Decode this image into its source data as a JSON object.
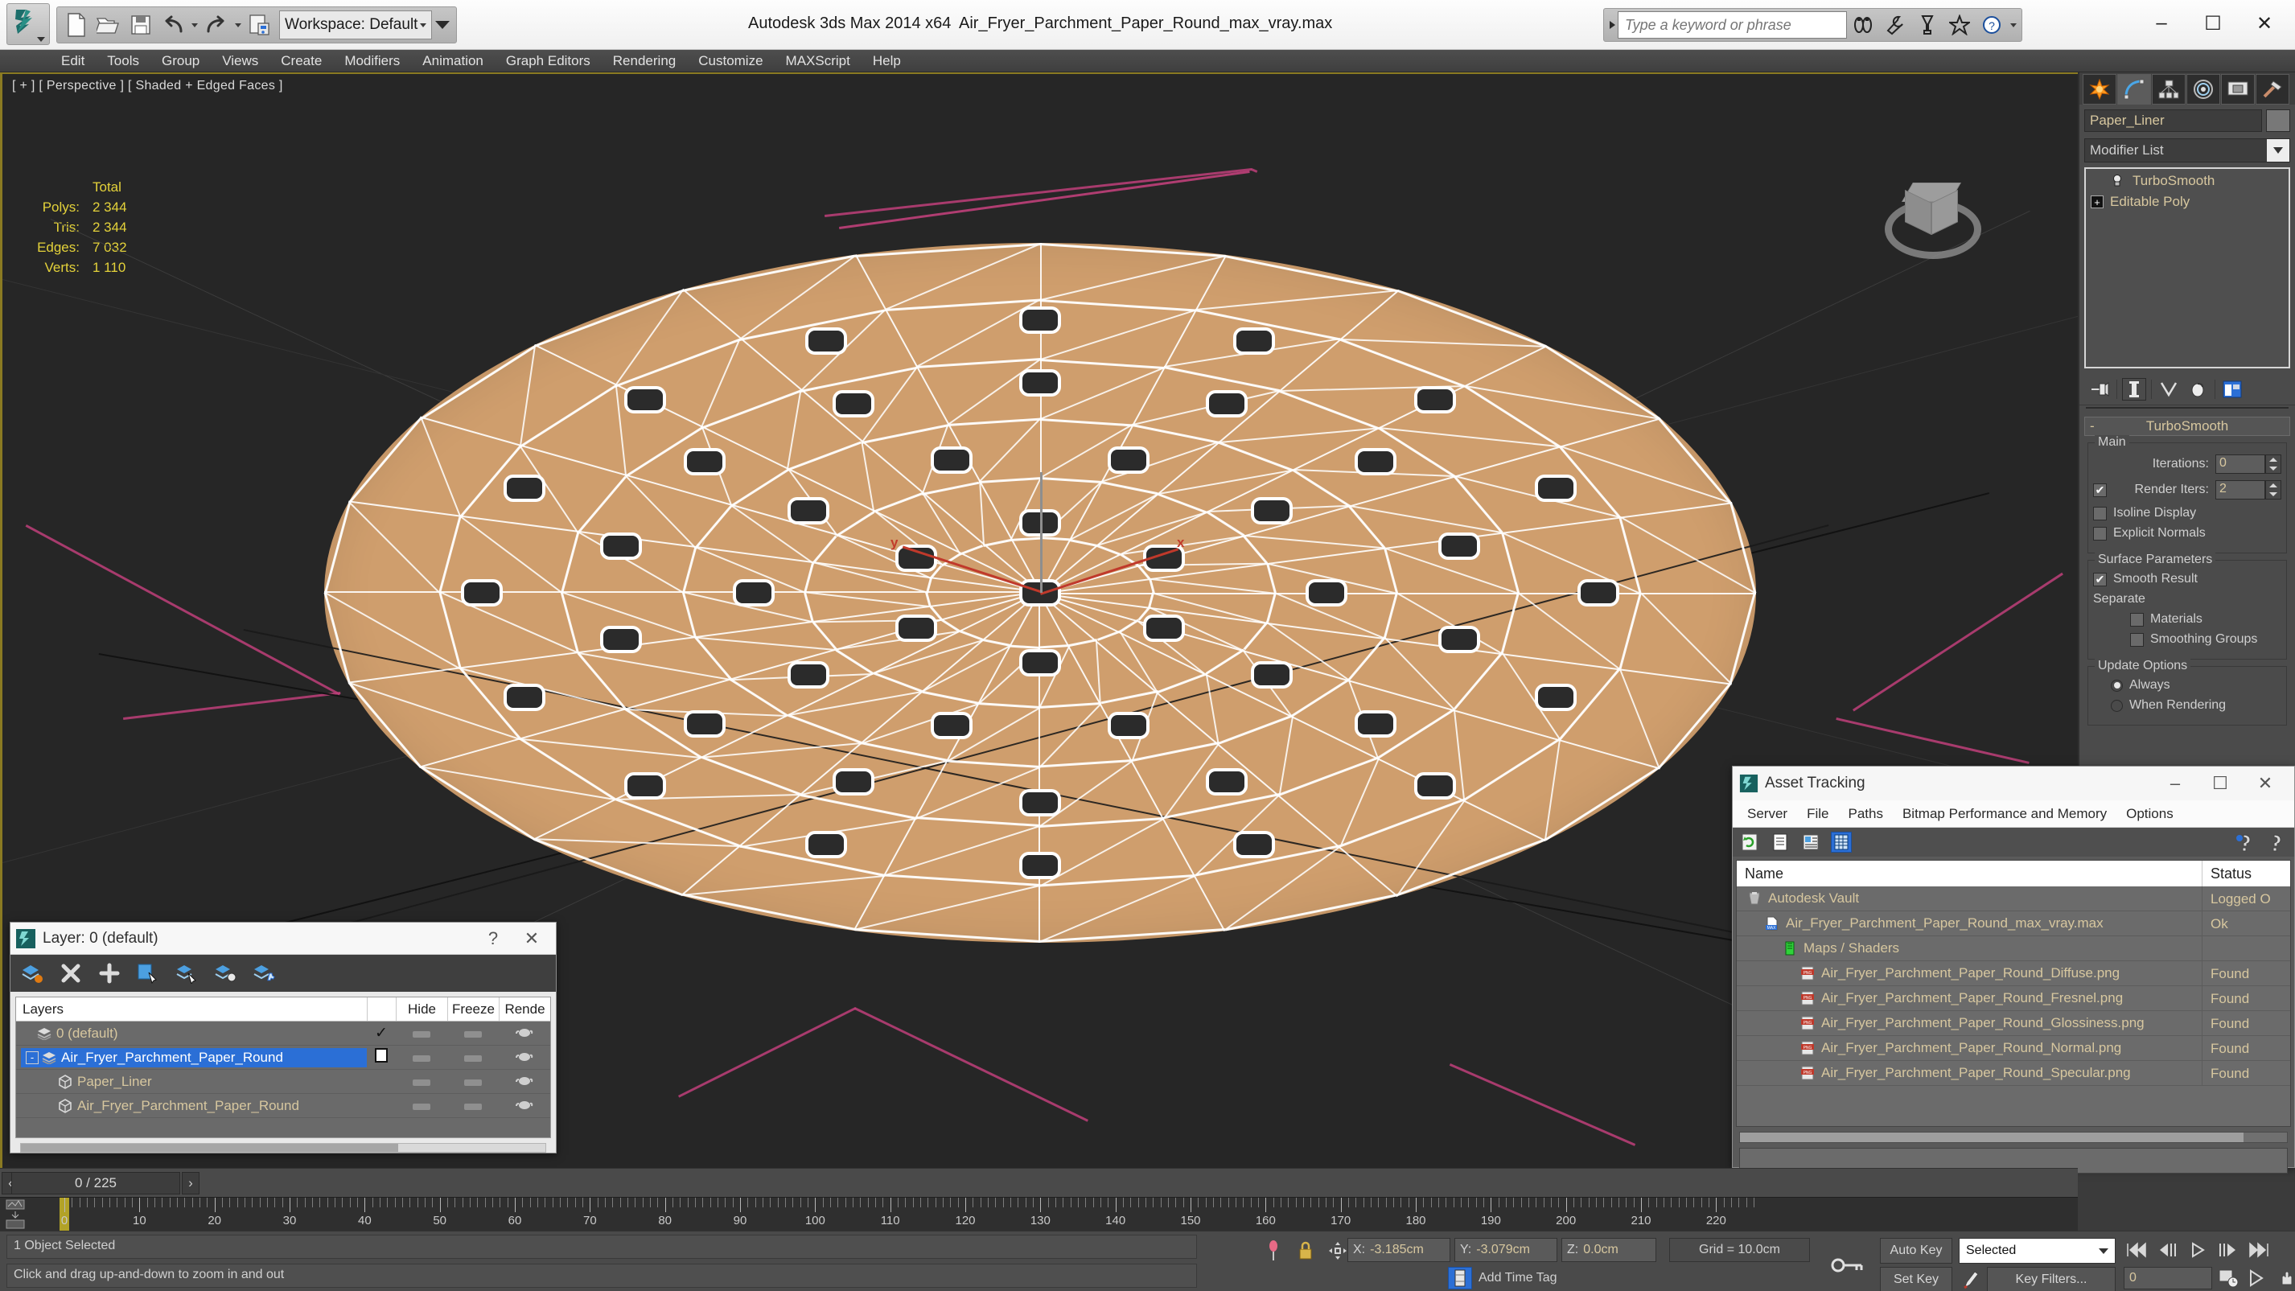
{
  "titlebar": {
    "app_title": "Autodesk 3ds Max  2014 x64",
    "file_title": "Air_Fryer_Parchment_Paper_Round_max_vray.max",
    "workspace_label": "Workspace: Default",
    "search_placeholder": "Type a keyword or phrase",
    "minimize": "–",
    "maximize": "☐",
    "close": "✕"
  },
  "menubar": {
    "items": [
      "Edit",
      "Tools",
      "Group",
      "Views",
      "Create",
      "Modifiers",
      "Animation",
      "Graph Editors",
      "Rendering",
      "Customize",
      "MAXScript",
      "Help"
    ]
  },
  "viewport": {
    "label": "[ + ] [ Perspective ] [ Shaded + Edged Faces ]",
    "stats_header": "Total",
    "stats": [
      {
        "label": "Polys:",
        "value": "2 344"
      },
      {
        "label": "Tris:",
        "value": "2 344"
      },
      {
        "label": "Edges:",
        "value": "7 032"
      },
      {
        "label": "Verts:",
        "value": "1 110"
      }
    ],
    "axis_x": "x",
    "axis_y": "y",
    "object_color": "#cf9e6d",
    "wire_color": "#ffffff",
    "background": "#262626"
  },
  "command_panel": {
    "tabs": [
      "create-tab",
      "modify-tab",
      "hierarchy-tab",
      "motion-tab",
      "display-tab",
      "utilities-tab"
    ],
    "object_name": "Paper_Liner",
    "modifier_list_label": "Modifier List",
    "stack": [
      {
        "label": "TurboSmooth",
        "selected": true
      },
      {
        "label": "Editable Poly",
        "selected": false
      }
    ],
    "rollout": {
      "title": "TurboSmooth",
      "collapse_glyph": "-",
      "groups": [
        {
          "title": "Main",
          "fields": [
            {
              "type": "spinner",
              "label": "Iterations:",
              "value": "0",
              "checkbox": null
            },
            {
              "type": "spinner",
              "label": "Render Iters:",
              "value": "2",
              "checkbox": true
            },
            {
              "type": "check",
              "label": "Isoline Display",
              "checked": false
            },
            {
              "type": "check",
              "label": "Explicit Normals",
              "checked": false
            }
          ]
        },
        {
          "title": "Surface Parameters",
          "fields": [
            {
              "type": "check",
              "label": "Smooth Result",
              "checked": true
            },
            {
              "type": "text",
              "label": "Separate"
            },
            {
              "type": "check",
              "label": "Materials",
              "checked": false,
              "indent": true
            },
            {
              "type": "check",
              "label": "Smoothing Groups",
              "checked": false,
              "indent": true
            }
          ]
        },
        {
          "title": "Update Options",
          "fields": [
            {
              "type": "radio",
              "label": "Always",
              "checked": true
            },
            {
              "type": "radio",
              "label": "When Rendering",
              "checked": false
            }
          ]
        }
      ]
    }
  },
  "layer_dialog": {
    "title": "Layer: 0 (default)",
    "help_glyph": "?",
    "close_glyph": "✕",
    "columns": {
      "name": "Layers",
      "hide": "Hide",
      "freeze": "Freeze",
      "render": "Rende"
    },
    "rows": [
      {
        "name": "0 (default)",
        "indent": 0,
        "icon": "layer-icon",
        "mark": "✓",
        "selected": false,
        "expander": ""
      },
      {
        "name": "Air_Fryer_Parchment_Paper_Round",
        "indent": 0,
        "icon": "layer-icon",
        "mark": "box",
        "selected": true,
        "expander": "-"
      },
      {
        "name": "Paper_Liner",
        "indent": 1,
        "icon": "object-icon",
        "mark": "",
        "selected": false,
        "expander": ""
      },
      {
        "name": "Air_Fryer_Parchment_Paper_Round",
        "indent": 1,
        "icon": "object-icon",
        "mark": "",
        "selected": false,
        "expander": ""
      }
    ]
  },
  "asset_tracking": {
    "title": "Asset Tracking",
    "minimize": "–",
    "maximize": "☐",
    "close": "✕",
    "menu": [
      "Server",
      "File",
      "Paths",
      "Bitmap Performance and Memory",
      "Options"
    ],
    "columns": {
      "name": "Name",
      "status": "Status"
    },
    "rows": [
      {
        "name": "Autodesk Vault",
        "status": "Logged O",
        "indent": 0,
        "icon": "vault-icon"
      },
      {
        "name": "Air_Fryer_Parchment_Paper_Round_max_vray.max",
        "status": "Ok",
        "indent": 1,
        "icon": "max-file-icon"
      },
      {
        "name": "Maps / Shaders",
        "status": "",
        "indent": 2,
        "icon": "maps-icon"
      },
      {
        "name": "Air_Fryer_Parchment_Paper_Round_Diffuse.png",
        "status": "Found",
        "indent": 3,
        "icon": "png-icon"
      },
      {
        "name": "Air_Fryer_Parchment_Paper_Round_Fresnel.png",
        "status": "Found",
        "indent": 3,
        "icon": "png-icon"
      },
      {
        "name": "Air_Fryer_Parchment_Paper_Round_Glossiness.png",
        "status": "Found",
        "indent": 3,
        "icon": "png-icon"
      },
      {
        "name": "Air_Fryer_Parchment_Paper_Round_Normal.png",
        "status": "Found",
        "indent": 3,
        "icon": "png-icon"
      },
      {
        "name": "Air_Fryer_Parchment_Paper_Round_Specular.png",
        "status": "Found",
        "indent": 3,
        "icon": "png-icon"
      }
    ]
  },
  "timeline": {
    "current_frame_label": "0 / 225",
    "prev_glyph": "‹",
    "next_glyph": "›",
    "ticks": [
      "0",
      "10",
      "20",
      "30",
      "40",
      "50",
      "60",
      "70",
      "80",
      "90",
      "100",
      "110",
      "120",
      "130",
      "140",
      "150",
      "160",
      "170",
      "180",
      "190",
      "200",
      "210",
      "220"
    ],
    "range_start": 0,
    "range_end": 225
  },
  "statusbar": {
    "object_selected": "1 Object Selected",
    "prompt": "Click and drag up-and-down to zoom in and out",
    "coord_x_label": "X:",
    "coord_x": "-3.185cm",
    "coord_y_label": "Y:",
    "coord_y": "-3.079cm",
    "coord_z_label": "Z:",
    "coord_z": "0.0cm",
    "grid": "Grid = 10.0cm",
    "add_time_tag": "Add Time Tag",
    "auto_key": "Auto Key",
    "set_key": "Set Key",
    "key_filters": "Key Filters...",
    "selection_level": "Selected",
    "frame_field": "0"
  }
}
